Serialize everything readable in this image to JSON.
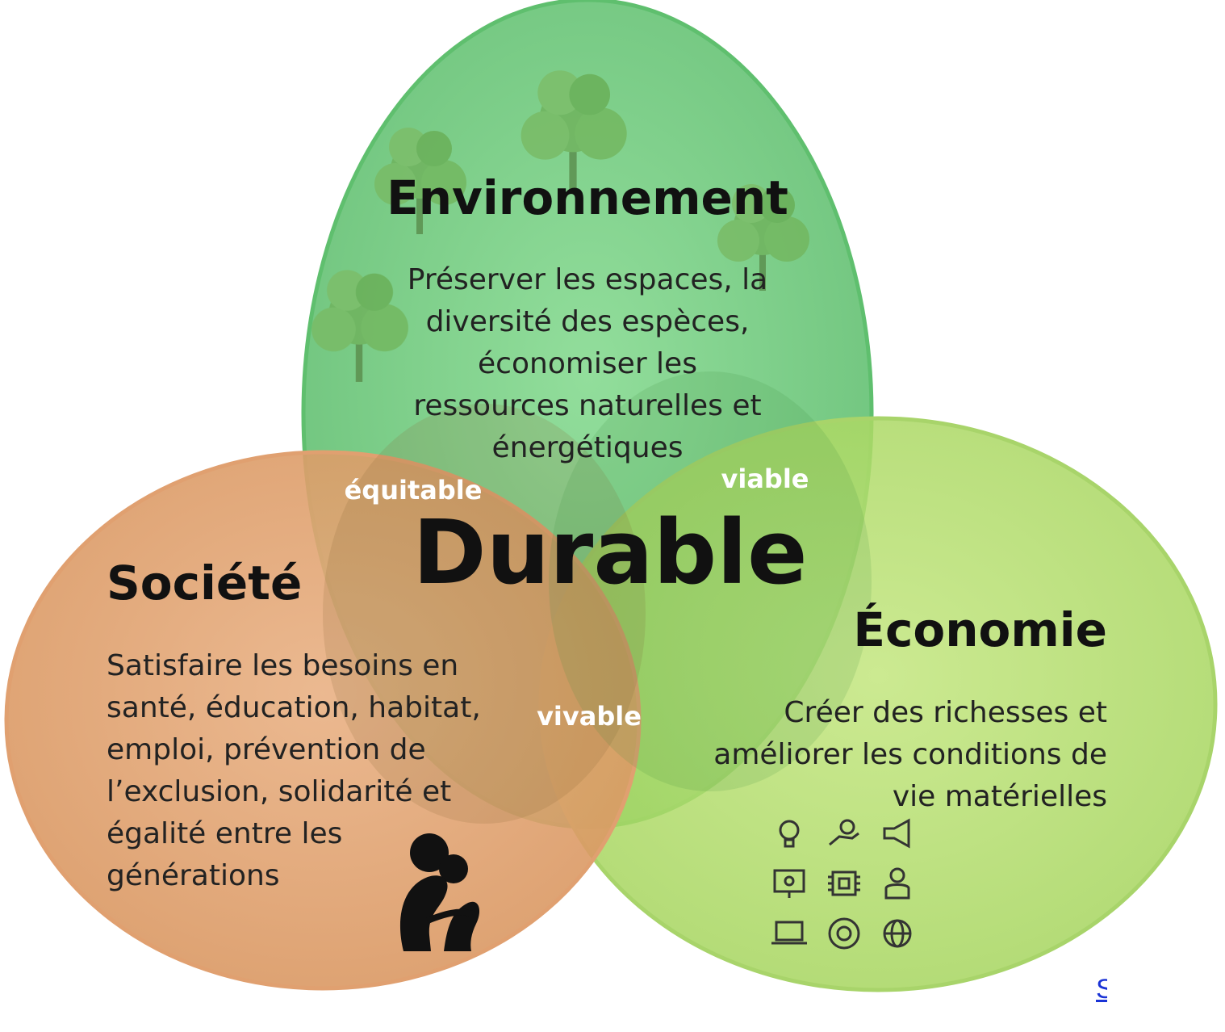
{
  "circles": {
    "environment": {
      "title": "Environnement",
      "lines": [
        "Préserver les espaces, la",
        "diversité des espèces,",
        "économiser les",
        "ressources naturelles et",
        "énergétiques"
      ],
      "fill": "#6fcf7b"
    },
    "society": {
      "title": "Société",
      "lines": [
        "Satisfaire les besoins en",
        "santé, éducation, habitat,",
        "emploi, prévention de",
        "l’exclusion, solidarité et",
        "égalité entre les",
        "générations"
      ],
      "fill": "#e3a877"
    },
    "economy": {
      "title": "Économie",
      "lines": [
        "Créer des richesses et",
        "améliorer les conditions de",
        "vie matérielles"
      ],
      "fill": "#b8e07a"
    }
  },
  "overlaps": {
    "equitable": "équitable",
    "viable": "viable",
    "vivable": "vivable"
  },
  "center": "Durable",
  "icons": {
    "society": "hug-people-icon",
    "economy": [
      "lightbulb-icon",
      "hand-coin-icon",
      "megaphone-icon",
      "presentation-board-icon",
      "chip-icon",
      "businessman-icon",
      "laptop-icon",
      "gear-cycle-icon",
      "globe-gear-icon"
    ],
    "environment": "trees-icon"
  },
  "source_link": "S"
}
